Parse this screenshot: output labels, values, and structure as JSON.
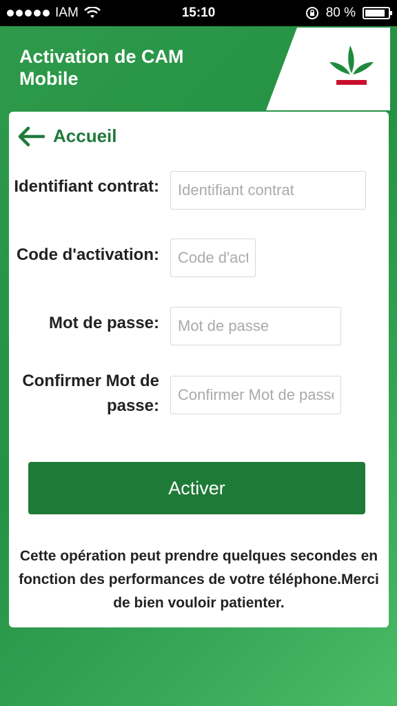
{
  "status_bar": {
    "carrier": "IAM",
    "time": "15:10",
    "battery_percent": "80 %",
    "battery_level": 0.8
  },
  "header": {
    "title": "Activation de CAM Mobile",
    "brand_colors": {
      "green": "#1e7a37",
      "red": "#c8102e"
    }
  },
  "nav": {
    "back_label": "Accueil",
    "back_icon": "arrow-left-icon"
  },
  "form": {
    "contract_id": {
      "label": "Identifiant contrat:",
      "placeholder": "Identifiant contrat",
      "value": ""
    },
    "activation_code": {
      "label": "Code d'activation:",
      "placeholder": "Code d'activation",
      "value": ""
    },
    "password": {
      "label": "Mot de passe:",
      "placeholder": "Mot de passe",
      "value": ""
    },
    "confirm_password": {
      "label": "Confirmer Mot de passe:",
      "placeholder": "Confirmer Mot de passe",
      "value": ""
    }
  },
  "actions": {
    "activate_label": "Activer"
  },
  "notice": "Cette opération peut prendre quelques secondes en fonction des performances de votre téléphone.Merci de bien vouloir patienter."
}
